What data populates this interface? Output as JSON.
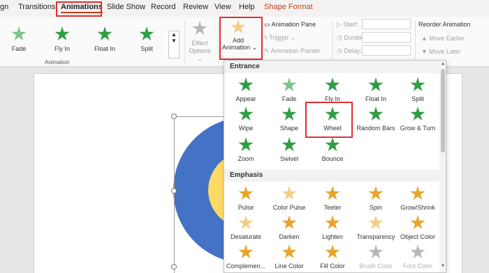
{
  "tabs": [
    "gn",
    "Transitions",
    "Animations",
    "Slide Show",
    "Record",
    "Review",
    "View",
    "Help",
    "Shape Format"
  ],
  "ribbon": {
    "effects": [
      "Fade",
      "Fly In",
      "Float In",
      "Split"
    ],
    "effect_options": "Effect Options",
    "effect_options_arrow": "⌄",
    "add_animation": [
      "Add",
      "Animation"
    ],
    "add_animation_arrow": "⌄",
    "animation_pane": "Animation Pane",
    "trigger": "Trigger",
    "animation_painter": "Animation Painter",
    "start": "Start:",
    "duration": "Duration:",
    "delay": "Delay:",
    "reorder_title": "Reorder Animation",
    "move_earlier": "Move Earlier",
    "move_later": "Move Later",
    "group_label": "Animation"
  },
  "gallery": {
    "entrance_title": "Entrance",
    "entrance": [
      "Appear",
      "Fade",
      "Fly In",
      "Float In",
      "Split",
      "Wipe",
      "Shape",
      "Wheel",
      "Random Bars",
      "Grow & Turn",
      "Zoom",
      "Swivel",
      "Bounce"
    ],
    "emphasis_title": "Emphasis",
    "emphasis": [
      "Pulse",
      "Color Pulse",
      "Teeter",
      "Spin",
      "Grow/Shrink",
      "Desaturate",
      "Darken",
      "Lighten",
      "Transparency",
      "Object Color",
      "Complemen...",
      "Line Color",
      "Fill Color",
      "Brush Color",
      "Font Color"
    ]
  },
  "colors": {
    "accent_red": "#e03030",
    "tab_underline": "#c43e1c",
    "star_green": "#2f9e44",
    "star_gold": "#e8a42b",
    "ring_blue": "#4472c4",
    "ring_yellow": "#ffd966"
  }
}
